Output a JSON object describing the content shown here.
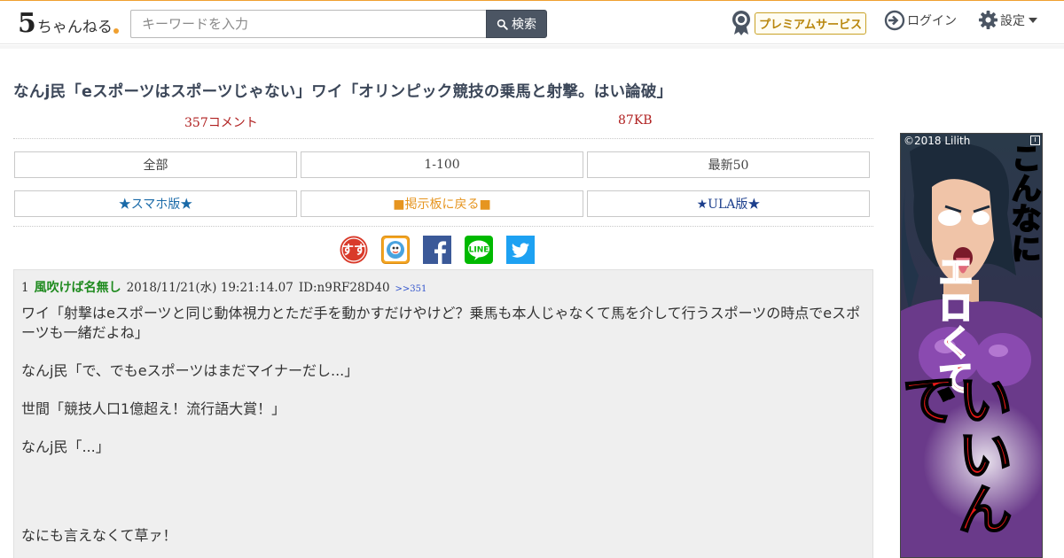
{
  "header": {
    "logo_num": "5",
    "logo_text": "ちゃんねる",
    "search_placeholder": "キーワードを入力",
    "search_button": "検索",
    "premium_label": "プレミアムサービス",
    "login_label": "ログイン",
    "settings_label": "設定"
  },
  "thread": {
    "title": "なんj民「eスポーツはスポーツじゃない」ワイ「オリンピック競技の乗馬と射撃。はい論破」",
    "comments": "357コメント",
    "size": "87KB"
  },
  "nav": {
    "all": "全部",
    "range": "1-100",
    "latest": "最新50",
    "smartphone": "★スマホ版★",
    "back_board": "■掲示板に戻る■",
    "ula": "★ULA版★"
  },
  "share_icons": [
    "sumaho-matome-icon",
    "matome-app-icon",
    "facebook-icon",
    "line-icon",
    "twitter-icon"
  ],
  "post": {
    "number": "1",
    "name": "風吹けば名無し",
    "date": "2018/11/21(水) 19:21:14.07",
    "id": "ID:n9RF28D40",
    "replies": ">>351",
    "lines": [
      "ワイ「射撃はeスポーツと同じ動体視力とただ手を動かすだけやけど？乗馬も本人じゃなくて馬を介して行うスポーツの時点でeスポーツも一緒だよね」",
      "なんj民「で、でもeスポーツはまだマイナーだし...」",
      "世間「競技人口1億超え！流行語大賞！」",
      "なんj民「...」",
      "なにも言えなくて草ァ！"
    ]
  },
  "ad": {
    "credit": "©2018 Lilith",
    "info": "i",
    "text_1": "こんなに",
    "text_2": "エロくて",
    "text_3": "いいんで"
  },
  "colors": {
    "accent_orange": "#f0a030",
    "title": "#3c4759",
    "meta_red": "#b02020",
    "name_green": "#1e8a1e"
  }
}
